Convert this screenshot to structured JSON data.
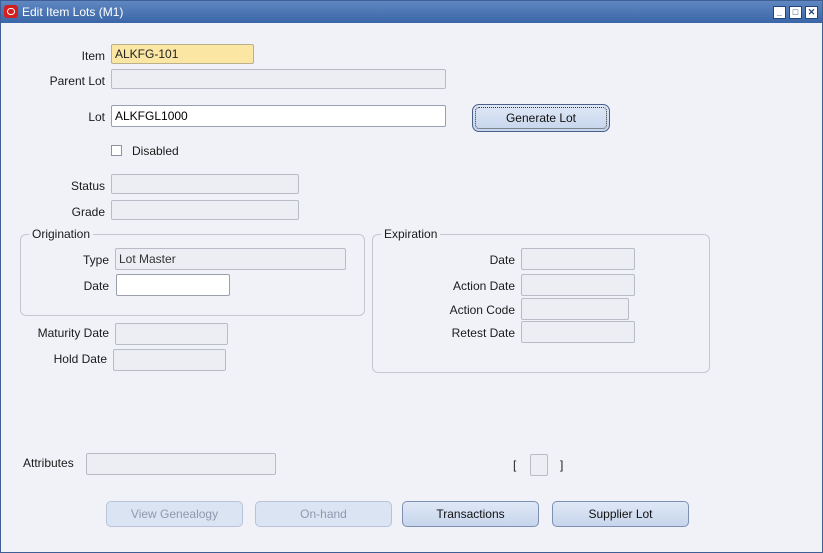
{
  "window": {
    "title": "Edit Item Lots (M1)",
    "buttons": {
      "minimize": "_",
      "maximize": "□",
      "close": "✕"
    }
  },
  "form": {
    "item_label": "Item",
    "item_value": "ALKFG-101",
    "parent_lot_label": "Parent Lot",
    "parent_lot_value": "",
    "lot_label": "Lot",
    "lot_value": "ALKFGL1000",
    "generate_lot_label": "Generate Lot",
    "disabled_label": "Disabled",
    "disabled_checked": false,
    "status_label": "Status",
    "status_value": "",
    "grade_label": "Grade",
    "grade_value": ""
  },
  "origination": {
    "title": "Origination",
    "type_label": "Type",
    "type_value": "Lot Master",
    "date_label": "Date",
    "date_value": ""
  },
  "expiration": {
    "title": "Expiration",
    "date_label": "Date",
    "date_value": "",
    "action_date_label": "Action Date",
    "action_date_value": "",
    "action_code_label": "Action Code",
    "action_code_value": "",
    "retest_date_label": "Retest Date",
    "retest_date_value": ""
  },
  "dates": {
    "maturity_label": "Maturity Date",
    "maturity_value": "",
    "hold_label": "Hold Date",
    "hold_value": ""
  },
  "attributes": {
    "label": "Attributes",
    "value": "",
    "dff_open": "[",
    "dff_close": "]"
  },
  "buttons": {
    "view_genealogy": "View Genealogy",
    "on_hand": "On-hand",
    "transactions": "Transactions",
    "supplier_lot": "Supplier Lot"
  },
  "colors": {
    "titlebar": "#3a66a8",
    "required_field": "#fbe7a3",
    "window_bg": "#f0f2f8"
  }
}
